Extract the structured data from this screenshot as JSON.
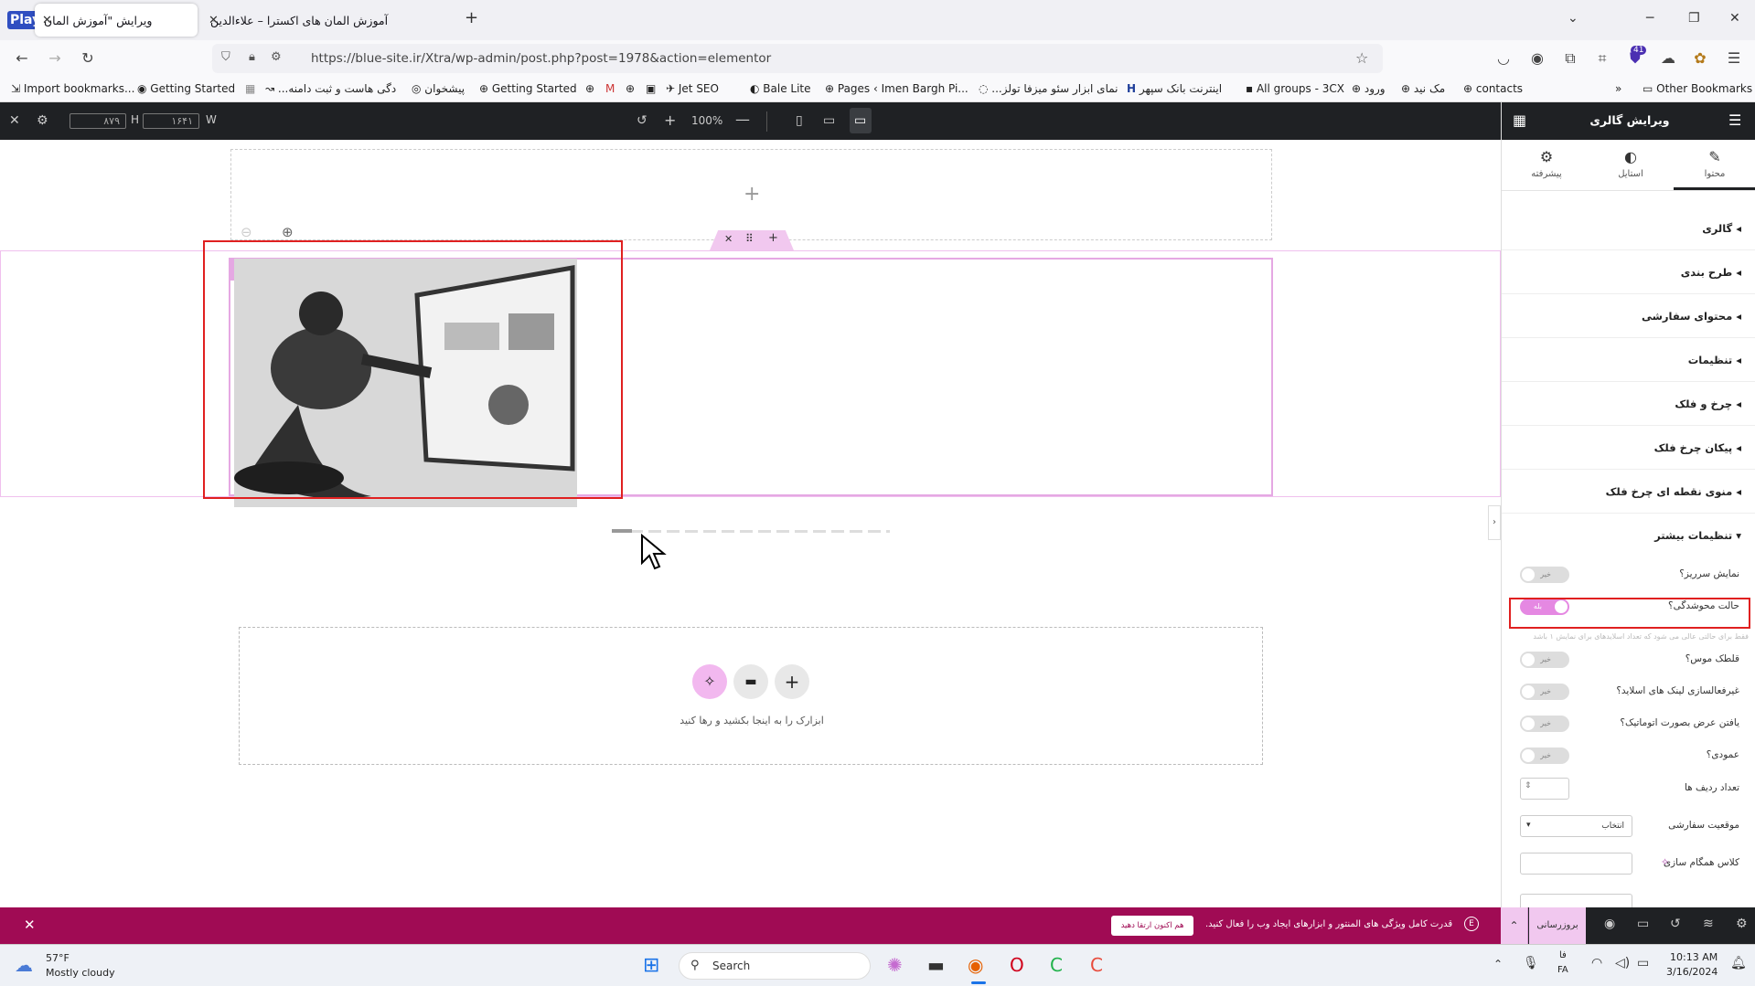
{
  "browser": {
    "playback_label": "Playback paused",
    "tabs": [
      {
        "title": "ویرایش \"آموزش المان"
      },
      {
        "title": "آموزش المان های اکسترا – علاءالدین"
      }
    ],
    "url": "https://blue-site.ir/Xtra/wp-admin/post.php?post=1978&action=elementor",
    "extension_badge": "41",
    "bookmarks": [
      "Import bookmarks...",
      "Getting Started",
      "...دگی هاست و ثبت دامنه",
      "پیشخوان",
      "Getting Started",
      "Jet SEO",
      "Bale Lite",
      "Pages ‹ Imen Bargh Pi...",
      "...نمای ابزار سئو میزفا تولز",
      "اینترنت بانک سپهر",
      "All groups - 3CX",
      "ورود",
      "مک نید",
      "contacts"
    ],
    "other_bookmarks": "Other Bookmarks"
  },
  "editor_top": {
    "height_label": "H",
    "height_value": "۸۷۹",
    "width_label": "W",
    "width_value": "۱۶۴۱",
    "zoom": "100%"
  },
  "canvas": {
    "drop_hint": "ابزارک را به اینجا بکشید و رها کنید"
  },
  "sidebar": {
    "title": "ویرایش گالری",
    "tabs": [
      {
        "label": "محتوا",
        "icon": "pencil-icon"
      },
      {
        "label": "استایل",
        "icon": "half-circle-icon"
      },
      {
        "label": "پیشرفته",
        "icon": "gear-icon"
      }
    ],
    "sections": [
      "گالری",
      "طرح بندی",
      "محتوای سفارشی",
      "تنظیمات",
      "چرخ و فلک",
      "پیکان چرخ فلک",
      "منوی نقطه ای چرخ فلک",
      "تنظیمات بیشتر"
    ],
    "controls": [
      {
        "label": "نمایش سرریز؟",
        "value": "خیر"
      },
      {
        "label": "حالت محوشدگی؟",
        "value": "بله"
      },
      {
        "label": "قلطک موس؟",
        "value": "خیر"
      },
      {
        "label": "غیرفعالسازی لینک های اسلاید؟",
        "value": "خیر"
      },
      {
        "label": "یافتن عرض بصورت اتوماتیک؟",
        "value": "خیر"
      },
      {
        "label": "عمودی؟",
        "value": "خیر"
      }
    ],
    "rows_label": "تعداد ردیف ها",
    "custom_position_label": "موقعیت سفارشی",
    "custom_position_value": "انتخاب",
    "sync_class_label": "کلاس همگام سازی",
    "fade_hint": "فقط برای حالتی عالی می شود که تعداد اسلایدهای برای نمایش ۱ باشد"
  },
  "notice": {
    "text": "قدرت کامل ویژگی های المنتور و ابزارهای ایجاد وب را فعال کنید.",
    "button": "هم اکنون ارتقا دهید",
    "publish": "بروزرسانی"
  },
  "taskbar": {
    "weather_temp": "57°F",
    "weather_desc": "Mostly cloudy",
    "search_placeholder": "Search",
    "lang_top": "فا",
    "lang_bottom": "FA",
    "time": "10:13 AM",
    "date": "3/16/2024"
  },
  "colors": {
    "elementor_dark": "#1f2124",
    "accent_pink": "#e588e2",
    "notice_bg": "#a00b54",
    "highlight_red": "#e02020"
  }
}
